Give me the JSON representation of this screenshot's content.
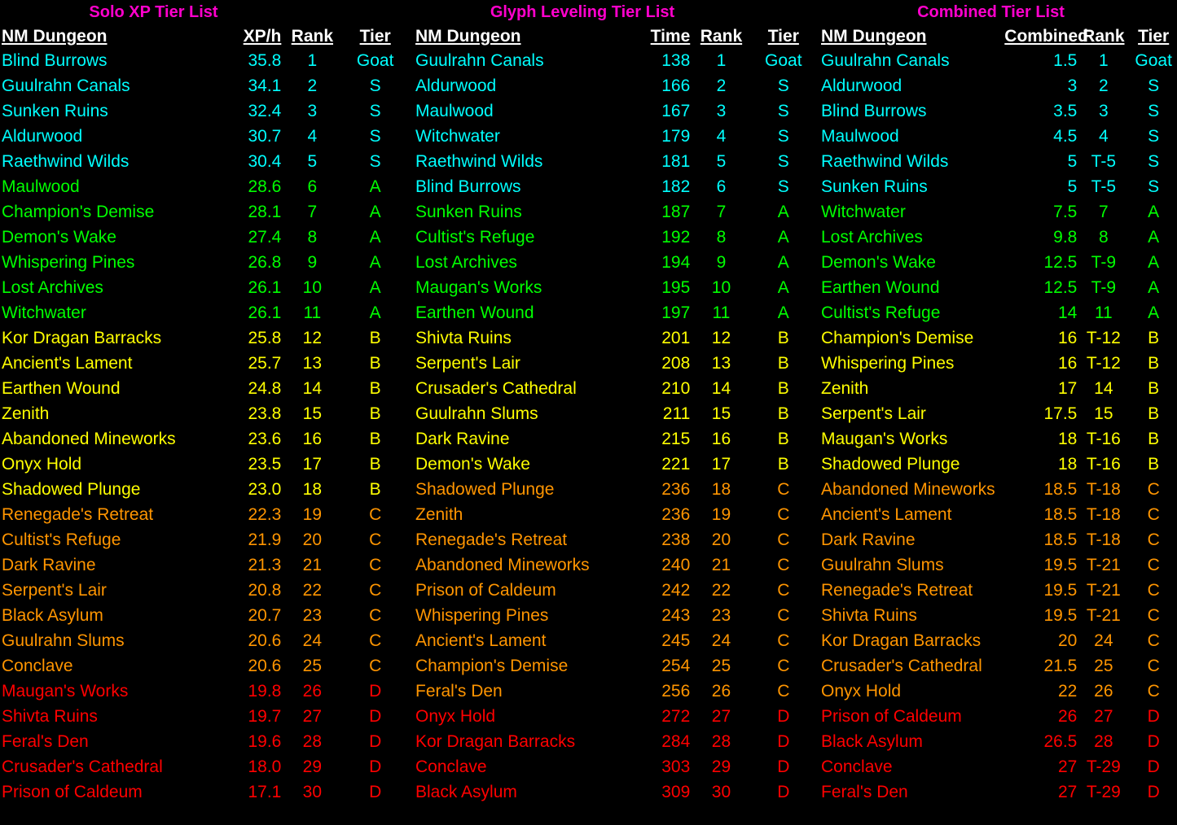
{
  "page": {
    "background_color": "#000000",
    "title_color": "#FF00CC",
    "header_color": "#FFFFFF",
    "tier_colors": {
      "Goat": "#00FFFF",
      "S": "#00FFFF",
      "A": "#00FF00",
      "B": "#FFFF00",
      "C": "#FF9500",
      "D": "#FF0000"
    }
  },
  "panels": [
    {
      "title": "Solo XP Tier List",
      "columns": [
        "NM Dungeon",
        "XP/h",
        "Rank",
        "Tier"
      ],
      "rows": [
        {
          "dungeon": "Blind Burrows",
          "metric": "35.8",
          "rank": "1",
          "tier": "Goat"
        },
        {
          "dungeon": "Guulrahn Canals",
          "metric": "34.1",
          "rank": "2",
          "tier": "S"
        },
        {
          "dungeon": "Sunken Ruins",
          "metric": "32.4",
          "rank": "3",
          "tier": "S"
        },
        {
          "dungeon": "Aldurwood",
          "metric": "30.7",
          "rank": "4",
          "tier": "S"
        },
        {
          "dungeon": "Raethwind Wilds",
          "metric": "30.4",
          "rank": "5",
          "tier": "S"
        },
        {
          "dungeon": "Maulwood",
          "metric": "28.6",
          "rank": "6",
          "tier": "A"
        },
        {
          "dungeon": "Champion's Demise",
          "metric": "28.1",
          "rank": "7",
          "tier": "A"
        },
        {
          "dungeon": "Demon's Wake",
          "metric": "27.4",
          "rank": "8",
          "tier": "A"
        },
        {
          "dungeon": "Whispering Pines",
          "metric": "26.8",
          "rank": "9",
          "tier": "A"
        },
        {
          "dungeon": "Lost Archives",
          "metric": "26.1",
          "rank": "10",
          "tier": "A"
        },
        {
          "dungeon": "Witchwater",
          "metric": "26.1",
          "rank": "11",
          "tier": "A"
        },
        {
          "dungeon": "Kor Dragan Barracks",
          "metric": "25.8",
          "rank": "12",
          "tier": "B"
        },
        {
          "dungeon": "Ancient's Lament",
          "metric": "25.7",
          "rank": "13",
          "tier": "B"
        },
        {
          "dungeon": "Earthen Wound",
          "metric": "24.8",
          "rank": "14",
          "tier": "B"
        },
        {
          "dungeon": "Zenith",
          "metric": "23.8",
          "rank": "15",
          "tier": "B"
        },
        {
          "dungeon": "Abandoned Mineworks",
          "metric": "23.6",
          "rank": "16",
          "tier": "B"
        },
        {
          "dungeon": "Onyx Hold",
          "metric": "23.5",
          "rank": "17",
          "tier": "B"
        },
        {
          "dungeon": "Shadowed Plunge",
          "metric": "23.0",
          "rank": "18",
          "tier": "B"
        },
        {
          "dungeon": "Renegade's Retreat",
          "metric": "22.3",
          "rank": "19",
          "tier": "C"
        },
        {
          "dungeon": "Cultist's Refuge",
          "metric": "21.9",
          "rank": "20",
          "tier": "C"
        },
        {
          "dungeon": "Dark Ravine",
          "metric": "21.3",
          "rank": "21",
          "tier": "C"
        },
        {
          "dungeon": "Serpent's Lair",
          "metric": "20.8",
          "rank": "22",
          "tier": "C"
        },
        {
          "dungeon": "Black Asylum",
          "metric": "20.7",
          "rank": "23",
          "tier": "C"
        },
        {
          "dungeon": "Guulrahn Slums",
          "metric": "20.6",
          "rank": "24",
          "tier": "C"
        },
        {
          "dungeon": "Conclave",
          "metric": "20.6",
          "rank": "25",
          "tier": "C"
        },
        {
          "dungeon": "Maugan's Works",
          "metric": "19.8",
          "rank": "26",
          "tier": "D"
        },
        {
          "dungeon": "Shivta Ruins",
          "metric": "19.7",
          "rank": "27",
          "tier": "D"
        },
        {
          "dungeon": "Feral's Den",
          "metric": "19.6",
          "rank": "28",
          "tier": "D"
        },
        {
          "dungeon": "Crusader's Cathedral",
          "metric": "18.0",
          "rank": "29",
          "tier": "D"
        },
        {
          "dungeon": "Prison of Caldeum",
          "metric": "17.1",
          "rank": "30",
          "tier": "D"
        }
      ]
    },
    {
      "title": "Glyph Leveling Tier List",
      "columns": [
        "NM Dungeon",
        "Time",
        "Rank",
        "Tier"
      ],
      "rows": [
        {
          "dungeon": "Guulrahn Canals",
          "metric": "138",
          "rank": "1",
          "tier": "Goat"
        },
        {
          "dungeon": "Aldurwood",
          "metric": "166",
          "rank": "2",
          "tier": "S"
        },
        {
          "dungeon": "Maulwood",
          "metric": "167",
          "rank": "3",
          "tier": "S"
        },
        {
          "dungeon": "Witchwater",
          "metric": "179",
          "rank": "4",
          "tier": "S"
        },
        {
          "dungeon": "Raethwind Wilds",
          "metric": "181",
          "rank": "5",
          "tier": "S"
        },
        {
          "dungeon": "Blind Burrows",
          "metric": "182",
          "rank": "6",
          "tier": "S"
        },
        {
          "dungeon": "Sunken Ruins",
          "metric": "187",
          "rank": "7",
          "tier": "A"
        },
        {
          "dungeon": "Cultist's Refuge",
          "metric": "192",
          "rank": "8",
          "tier": "A"
        },
        {
          "dungeon": "Lost Archives",
          "metric": "194",
          "rank": "9",
          "tier": "A"
        },
        {
          "dungeon": "Maugan's Works",
          "metric": "195",
          "rank": "10",
          "tier": "A"
        },
        {
          "dungeon": "Earthen Wound",
          "metric": "197",
          "rank": "11",
          "tier": "A"
        },
        {
          "dungeon": "Shivta Ruins",
          "metric": "201",
          "rank": "12",
          "tier": "B"
        },
        {
          "dungeon": "Serpent's Lair",
          "metric": "208",
          "rank": "13",
          "tier": "B"
        },
        {
          "dungeon": "Crusader's Cathedral",
          "metric": "210",
          "rank": "14",
          "tier": "B"
        },
        {
          "dungeon": "Guulrahn Slums",
          "metric": "211",
          "rank": "15",
          "tier": "B"
        },
        {
          "dungeon": "Dark Ravine",
          "metric": "215",
          "rank": "16",
          "tier": "B"
        },
        {
          "dungeon": "Demon's Wake",
          "metric": "221",
          "rank": "17",
          "tier": "B"
        },
        {
          "dungeon": "Shadowed Plunge",
          "metric": "236",
          "rank": "18",
          "tier": "C"
        },
        {
          "dungeon": "Zenith",
          "metric": "236",
          "rank": "19",
          "tier": "C"
        },
        {
          "dungeon": "Renegade's Retreat",
          "metric": "238",
          "rank": "20",
          "tier": "C"
        },
        {
          "dungeon": "Abandoned Mineworks",
          "metric": "240",
          "rank": "21",
          "tier": "C"
        },
        {
          "dungeon": "Prison of Caldeum",
          "metric": "242",
          "rank": "22",
          "tier": "C"
        },
        {
          "dungeon": "Whispering Pines",
          "metric": "243",
          "rank": "23",
          "tier": "C"
        },
        {
          "dungeon": "Ancient's Lament",
          "metric": "245",
          "rank": "24",
          "tier": "C"
        },
        {
          "dungeon": "Champion's Demise",
          "metric": "254",
          "rank": "25",
          "tier": "C"
        },
        {
          "dungeon": "Feral's Den",
          "metric": "256",
          "rank": "26",
          "tier": "C"
        },
        {
          "dungeon": "Onyx Hold",
          "metric": "272",
          "rank": "27",
          "tier": "D"
        },
        {
          "dungeon": "Kor Dragan Barracks",
          "metric": "284",
          "rank": "28",
          "tier": "D"
        },
        {
          "dungeon": "Conclave",
          "metric": "303",
          "rank": "29",
          "tier": "D"
        },
        {
          "dungeon": "Black Asylum",
          "metric": "309",
          "rank": "30",
          "tier": "D"
        }
      ]
    },
    {
      "title": "Combined Tier List",
      "columns": [
        "NM Dungeon",
        "Combined",
        "Rank",
        "Tier"
      ],
      "rows": [
        {
          "dungeon": "Guulrahn Canals",
          "metric": "1.5",
          "rank": "1",
          "tier": "Goat"
        },
        {
          "dungeon": "Aldurwood",
          "metric": "3",
          "rank": "2",
          "tier": "S"
        },
        {
          "dungeon": "Blind Burrows",
          "metric": "3.5",
          "rank": "3",
          "tier": "S"
        },
        {
          "dungeon": "Maulwood",
          "metric": "4.5",
          "rank": "4",
          "tier": "S"
        },
        {
          "dungeon": "Raethwind Wilds",
          "metric": "5",
          "rank": "T-5",
          "tier": "S"
        },
        {
          "dungeon": "Sunken Ruins",
          "metric": "5",
          "rank": "T-5",
          "tier": "S"
        },
        {
          "dungeon": "Witchwater",
          "metric": "7.5",
          "rank": "7",
          "tier": "A"
        },
        {
          "dungeon": "Lost Archives",
          "metric": "9.8",
          "rank": "8",
          "tier": "A"
        },
        {
          "dungeon": "Demon's Wake",
          "metric": "12.5",
          "rank": "T-9",
          "tier": "A"
        },
        {
          "dungeon": "Earthen Wound",
          "metric": "12.5",
          "rank": "T-9",
          "tier": "A"
        },
        {
          "dungeon": "Cultist's Refuge",
          "metric": "14",
          "rank": "11",
          "tier": "A"
        },
        {
          "dungeon": "Champion's Demise",
          "metric": "16",
          "rank": "T-12",
          "tier": "B"
        },
        {
          "dungeon": "Whispering Pines",
          "metric": "16",
          "rank": "T-12",
          "tier": "B"
        },
        {
          "dungeon": "Zenith",
          "metric": "17",
          "rank": "14",
          "tier": "B"
        },
        {
          "dungeon": "Serpent's Lair",
          "metric": "17.5",
          "rank": "15",
          "tier": "B"
        },
        {
          "dungeon": "Maugan's Works",
          "metric": "18",
          "rank": "T-16",
          "tier": "B"
        },
        {
          "dungeon": "Shadowed Plunge",
          "metric": "18",
          "rank": "T-16",
          "tier": "B"
        },
        {
          "dungeon": "Abandoned Mineworks",
          "metric": "18.5",
          "rank": "T-18",
          "tier": "C"
        },
        {
          "dungeon": "Ancient's Lament",
          "metric": "18.5",
          "rank": "T-18",
          "tier": "C"
        },
        {
          "dungeon": "Dark Ravine",
          "metric": "18.5",
          "rank": "T-18",
          "tier": "C"
        },
        {
          "dungeon": "Guulrahn Slums",
          "metric": "19.5",
          "rank": "T-21",
          "tier": "C"
        },
        {
          "dungeon": "Renegade's Retreat",
          "metric": "19.5",
          "rank": "T-21",
          "tier": "C"
        },
        {
          "dungeon": "Shivta Ruins",
          "metric": "19.5",
          "rank": "T-21",
          "tier": "C"
        },
        {
          "dungeon": "Kor Dragan Barracks",
          "metric": "20",
          "rank": "24",
          "tier": "C"
        },
        {
          "dungeon": "Crusader's Cathedral",
          "metric": "21.5",
          "rank": "25",
          "tier": "C"
        },
        {
          "dungeon": "Onyx Hold",
          "metric": "22",
          "rank": "26",
          "tier": "C"
        },
        {
          "dungeon": "Prison of Caldeum",
          "metric": "26",
          "rank": "27",
          "tier": "D"
        },
        {
          "dungeon": "Black Asylum",
          "metric": "26.5",
          "rank": "28",
          "tier": "D"
        },
        {
          "dungeon": "Conclave",
          "metric": "27",
          "rank": "T-29",
          "tier": "D"
        },
        {
          "dungeon": "Feral's Den",
          "metric": "27",
          "rank": "T-29",
          "tier": "D"
        }
      ]
    }
  ]
}
